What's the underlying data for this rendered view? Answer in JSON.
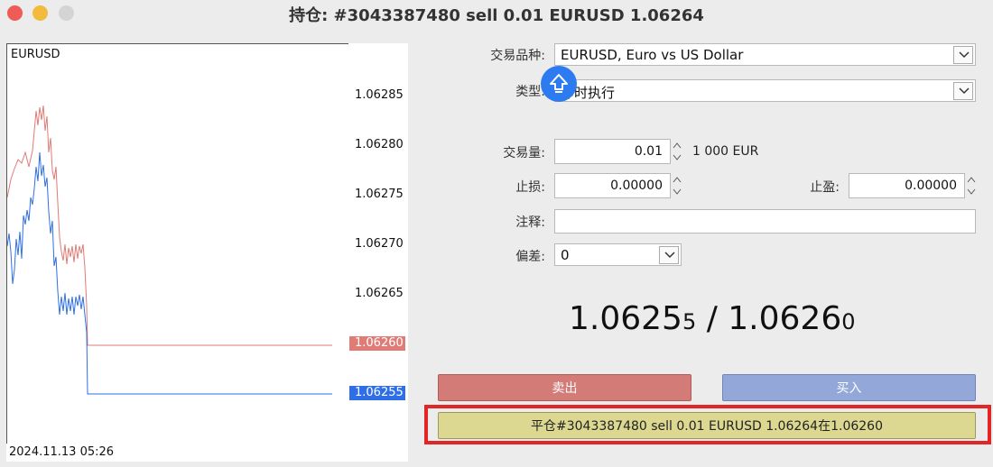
{
  "window": {
    "title": "持仓: #3043387480 sell 0.01 EURUSD 1.06264"
  },
  "chart": {
    "symbol": "EURUSD",
    "y_ticks": [
      "1.06285",
      "1.06280",
      "1.06275",
      "1.06270",
      "1.06265"
    ],
    "sell_price_tag": "1.06260",
    "buy_price_tag": "1.06255",
    "time_label": "2024.11.13 05:26",
    "colors": {
      "ask_line": "#e07b76",
      "bid_line": "#2e6ee8"
    }
  },
  "form": {
    "symbol_label": "交易品种:",
    "symbol_value": "EURUSD, Euro vs US Dollar",
    "type_label": "类型:",
    "type_value": "即时执行",
    "volume_label": "交易量:",
    "volume_value": "0.01",
    "volume_unit": "1 000 EUR",
    "sl_label": "止损:",
    "sl_value": "0.00000",
    "tp_label": "止盈:",
    "tp_value": "0.00000",
    "comment_label": "注释:",
    "comment_value": "",
    "deviation_label": "偏差:",
    "deviation_value": "0"
  },
  "quote": {
    "bid_main": "1.0625",
    "bid_small": "5",
    "separator": " / ",
    "ask_main": "1.0626",
    "ask_small": "0"
  },
  "buttons": {
    "sell": "卖出",
    "buy": "买入",
    "close": "平仓#3043387480 sell 0.01 EURUSD 1.06264在1.06260"
  },
  "icons": {
    "floating": "shift-up-arrow-icon",
    "dropdown": "chevron-down-icon",
    "spinner": "spinner-arrows-icon"
  }
}
